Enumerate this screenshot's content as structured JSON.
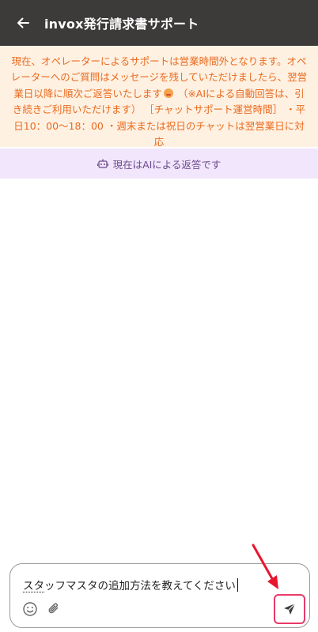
{
  "header": {
    "title": "invox発行請求書サポート",
    "back_icon": "arrow-left-icon"
  },
  "notice": {
    "text_before_emoji": "現在、オペレーターによるサポートは営業時間外となります。オペレーターへのご質問はメッセージを残していただけましたら、翌営業日以降に順次ご返答いたします",
    "text_after_emoji": " （※AIによる自動回答は、引き続きご利用いただけます） ［チャットサポート運営時間］ ・平日10：00〜18：00 ・週末または祝日のチャットは翌営業日に対応",
    "color": "#ea6a1e",
    "background": "#fff1e2"
  },
  "ai_status": {
    "label": "現在はAIによる返答です",
    "icon": "robot-icon"
  },
  "composer": {
    "underlined_text": "スタ",
    "text_rest": "ッフマスタの追加方法を教えてください",
    "emoji_icon": "smiley-icon",
    "attach_icon": "paperclip-icon",
    "send_icon": "send-icon"
  },
  "annotation": {
    "arrow_color": "#e8152e",
    "highlight_color": "#e83a6a"
  }
}
